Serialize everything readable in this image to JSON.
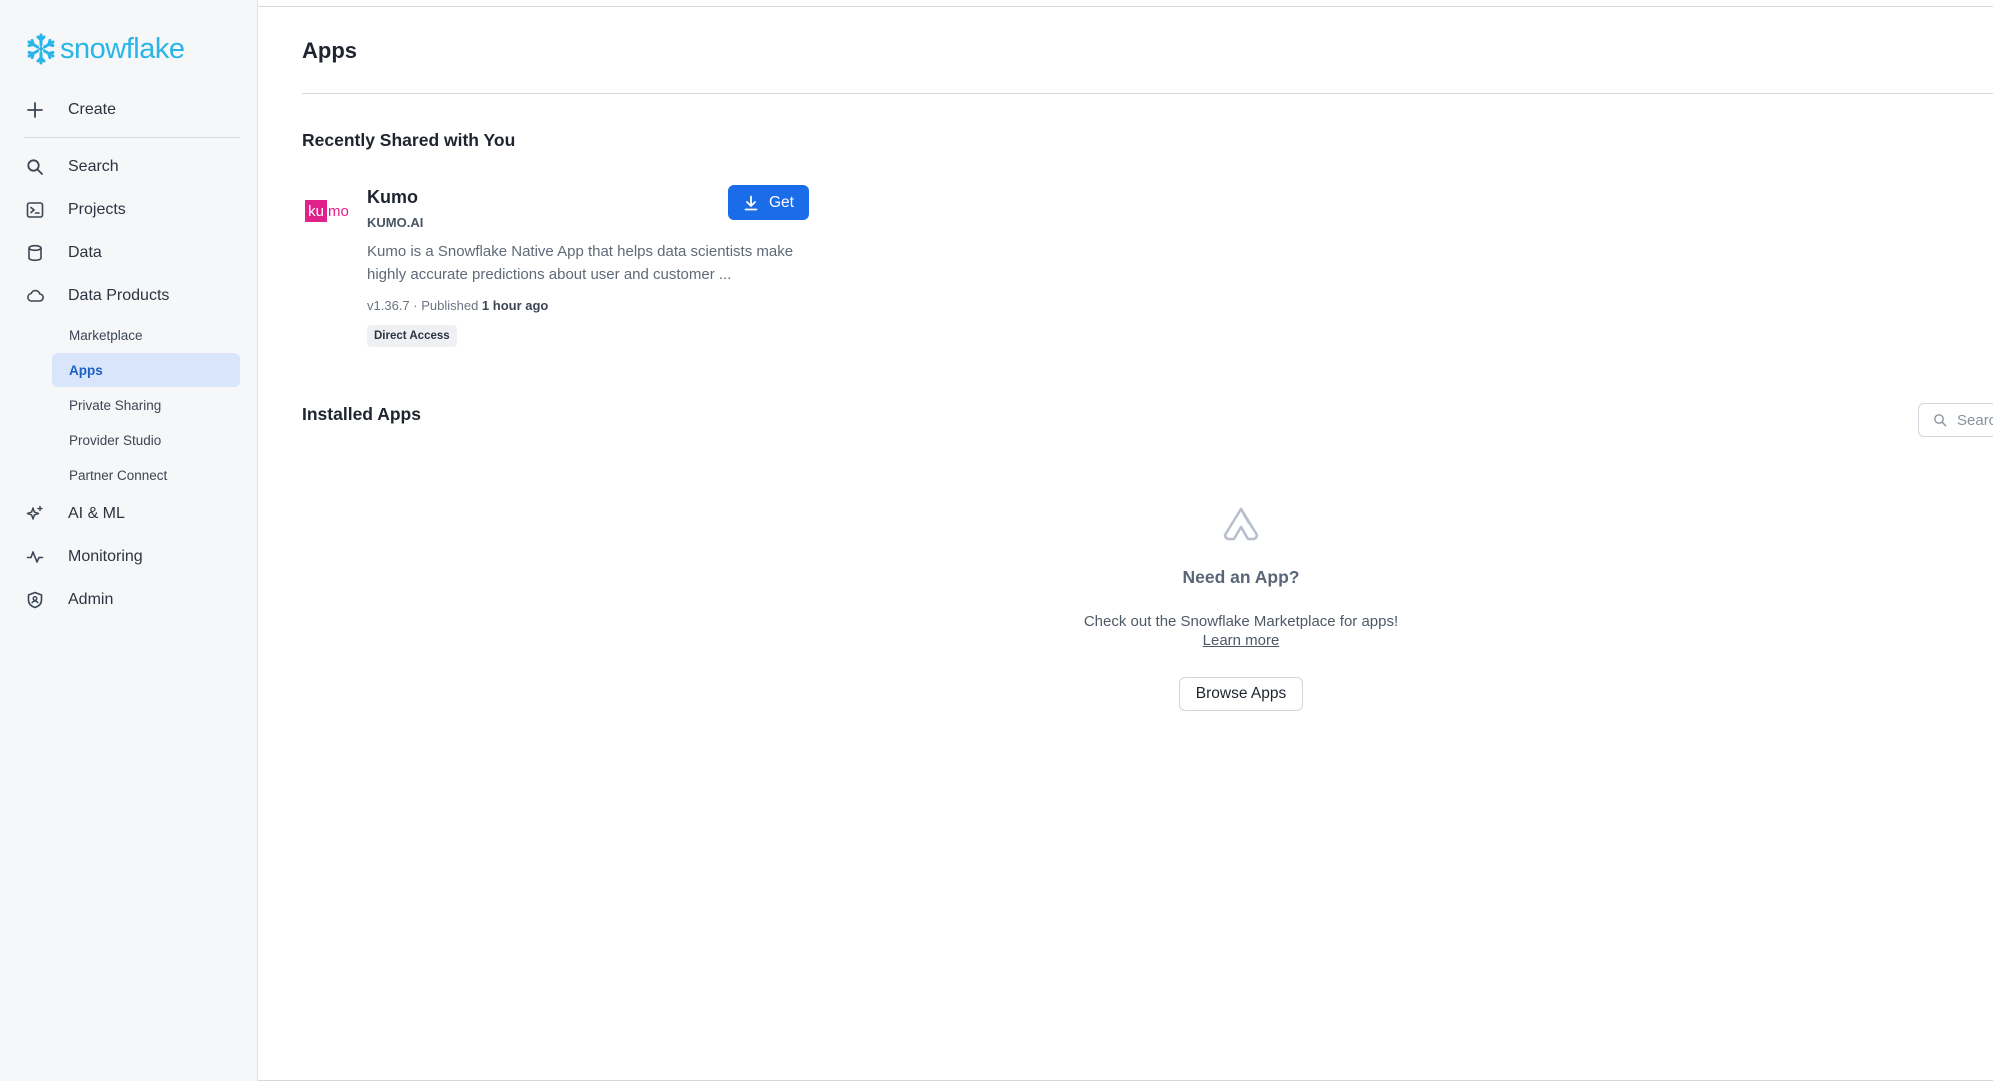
{
  "brand": {
    "name": "snowflake",
    "color": "#29b5e8"
  },
  "sidebar": {
    "create_label": "Create",
    "items": [
      {
        "label": "Search",
        "icon": "search-icon"
      },
      {
        "label": "Projects",
        "icon": "terminal-icon"
      },
      {
        "label": "Data",
        "icon": "database-icon"
      },
      {
        "label": "Data Products",
        "icon": "cloud-icon"
      }
    ],
    "sub_items": [
      {
        "label": "Marketplace"
      },
      {
        "label": "Apps",
        "active": true
      },
      {
        "label": "Private Sharing"
      },
      {
        "label": "Provider Studio"
      },
      {
        "label": "Partner Connect"
      }
    ],
    "bottom_items": [
      {
        "label": "AI & ML",
        "icon": "sparkle-icon"
      },
      {
        "label": "Monitoring",
        "icon": "activity-icon"
      },
      {
        "label": "Admin",
        "icon": "shield-icon"
      }
    ]
  },
  "main": {
    "title": "Apps",
    "recent_heading": "Recently Shared with You",
    "installed_heading": "Installed Apps",
    "search_placeholder": "Search"
  },
  "app_card": {
    "logo_text_k": "ku",
    "logo_text_mo": "mo",
    "logo_color": "#e0218a",
    "name": "Kumo",
    "provider": "KUMO.AI",
    "description": "Kumo is a Snowflake Native App that helps data scientists make highly accurate predictions about user and customer ...",
    "version": "v1.36.7",
    "meta_separator": " · Published ",
    "published": "1 hour ago",
    "tag": "Direct Access",
    "get_label": "Get",
    "get_color": "#1a6ce8"
  },
  "empty_state": {
    "icon": "app-icon",
    "title": "Need an App?",
    "text": "Check out the Snowflake Marketplace for apps!",
    "link": "Learn more",
    "button": "Browse Apps"
  }
}
